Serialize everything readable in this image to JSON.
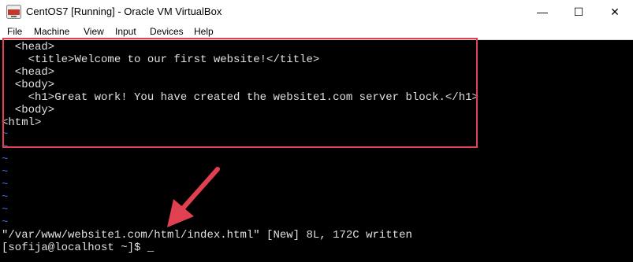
{
  "window": {
    "title": "CentOS7 [Running] - Oracle VM VirtualBox",
    "minimize": "—",
    "maximize": "☐",
    "close": "✕"
  },
  "menu": [
    "File",
    "Machine",
    "View",
    "Input",
    "Devices",
    "Help"
  ],
  "terminal": {
    "lines": [
      "  <head>",
      "    <title>Welcome to our first website!</title>",
      "  <head>",
      "  <body>",
      "    <h1>Great work! You have created the website1.com server block.</h1>",
      "  <body>",
      "<html>",
      "~",
      "~",
      "~",
      "~",
      "~",
      "~",
      "~",
      "~",
      "\"/var/www/website1.com/html/index.html\" [New] 8L, 172C written",
      "[sofija@localhost ~]$ _"
    ]
  },
  "colors": {
    "annotation": "#e04050",
    "tilde": "#3a6bd8"
  },
  "icons": {
    "app": "virtualbox-icon",
    "arrow": "annotation-arrow-icon"
  }
}
